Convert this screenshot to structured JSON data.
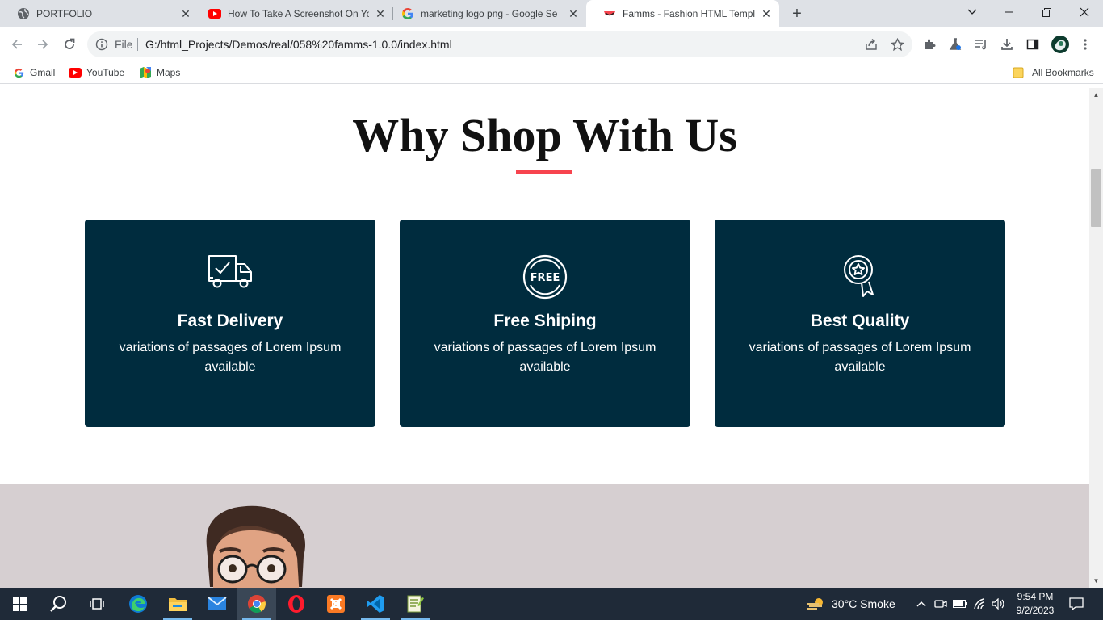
{
  "tabs": [
    {
      "title": "PORTFOLIO",
      "icon": "globe-icon"
    },
    {
      "title": "How To Take A Screenshot On Yo",
      "icon": "youtube-icon"
    },
    {
      "title": "marketing logo png - Google Se",
      "icon": "google-icon"
    },
    {
      "title": "Famms - Fashion HTML Templat",
      "icon": "famms-icon",
      "active": true
    }
  ],
  "address": {
    "scheme_label": "File",
    "url": "G:/html_Projects/Demos/real/058%20famms-1.0.0/index.html"
  },
  "bookmarks": [
    {
      "label": "Gmail",
      "icon": "google-icon"
    },
    {
      "label": "YouTube",
      "icon": "youtube-icon"
    },
    {
      "label": "Maps",
      "icon": "maps-icon"
    }
  ],
  "bookmarks_folder": "All Bookmarks",
  "page": {
    "heading": "Why Shop With Us",
    "accent_color": "#f7444e",
    "card_color": "#002c3e",
    "cards": [
      {
        "icon": "delivery-truck-icon",
        "title": "Fast Delivery",
        "desc": "variations of passages of Lorem Ipsum available"
      },
      {
        "icon": "free-badge-icon",
        "title": "Free Shiping",
        "desc": "variations of passages of Lorem Ipsum available"
      },
      {
        "icon": "quality-medal-icon",
        "title": "Best Quality",
        "desc": "variations of passages of Lorem Ipsum available"
      }
    ]
  },
  "taskbar": {
    "weather": "30°C  Smoke",
    "time": "9:54 PM",
    "date": "9/2/2023"
  }
}
